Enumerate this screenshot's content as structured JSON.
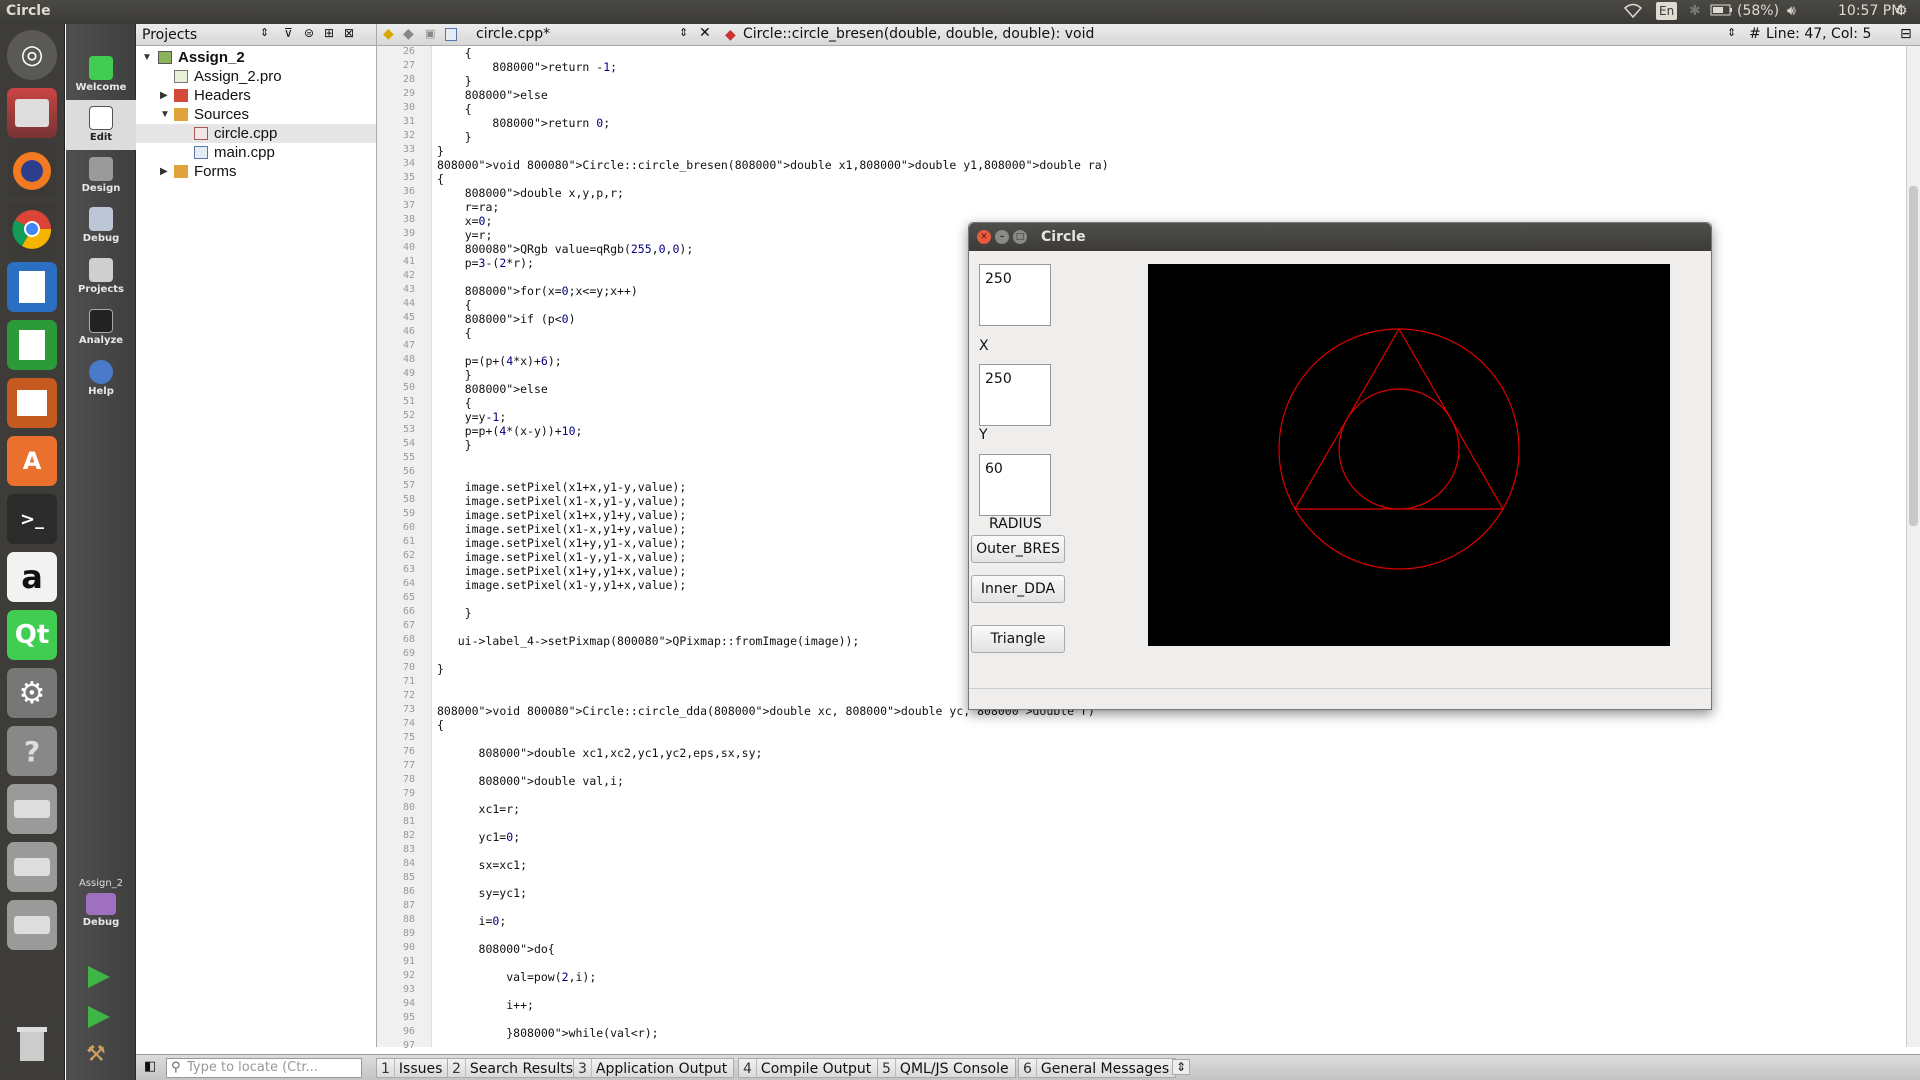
{
  "topbar": {
    "title": "Circle",
    "keyboard": "En",
    "battery": "(58%)",
    "time": "10:57 PM"
  },
  "launcher": {
    "items": [
      "ubuntu-dash",
      "files",
      "firefox",
      "chrome",
      "writer",
      "calc",
      "impress",
      "software-center",
      "terminal",
      "amazon",
      "qt-creator",
      "system-settings",
      "help",
      "drive-1",
      "drive-2",
      "drive-3",
      "trash"
    ]
  },
  "modes": {
    "items": [
      {
        "label": "Welcome",
        "icon": "qt-logo-icon"
      },
      {
        "label": "Edit",
        "icon": "edit-document-icon"
      },
      {
        "label": "Design",
        "icon": "design-pen-icon"
      },
      {
        "label": "Debug",
        "icon": "debug-bug-icon"
      },
      {
        "label": "Projects",
        "icon": "projects-wrench-icon"
      },
      {
        "label": "Analyze",
        "icon": "analyze-monitor-icon"
      },
      {
        "label": "Help",
        "icon": "help-icon"
      }
    ],
    "kit_project": "Assign_2",
    "kit_mode": "Debug"
  },
  "projects": {
    "header": "Projects",
    "tree": [
      {
        "label": "Assign_2",
        "level": 0,
        "twisty": "▼",
        "bold": true
      },
      {
        "label": "Assign_2.pro",
        "level": 1,
        "twisty": ""
      },
      {
        "label": "Headers",
        "level": 1,
        "twisty": "▶"
      },
      {
        "label": "Sources",
        "level": 1,
        "twisty": "▼"
      },
      {
        "label": "circle.cpp",
        "level": 2,
        "twisty": "",
        "selected": true
      },
      {
        "label": "main.cpp",
        "level": 2,
        "twisty": ""
      },
      {
        "label": "Forms",
        "level": 1,
        "twisty": "▶"
      }
    ]
  },
  "editor": {
    "file_name": "circle.cpp*",
    "function_name": "Circle::circle_bresen(double, double, double): void",
    "position": "Line: 47, Col: 5",
    "first_line_number": 26,
    "lines": [
      "    {",
      "        return -1;",
      "    }",
      "    else",
      "    {",
      "        return 0;",
      "    }",
      "}",
      "void Circle::circle_bresen(double x1,double y1,double ra)",
      "{",
      "    double x,y,p,r;",
      "    r=ra;",
      "    x=0;",
      "    y=r;",
      "    QRgb value=qRgb(255,0,0);",
      "    p=3-(2*r);",
      "",
      "    for(x=0;x<=y;x++)",
      "    {",
      "    if (p<0)",
      "    {",
      "",
      "    p=(p+(4*x)+6);",
      "    }",
      "    else",
      "    {",
      "    y=y-1;",
      "    p=p+(4*(x-y))+10;",
      "    }",
      "",
      "",
      "    image.setPixel(x1+x,y1-y,value);",
      "    image.setPixel(x1-x,y1-y,value);",
      "    image.setPixel(x1+x,y1+y,value);",
      "    image.setPixel(x1-x,y1+y,value);",
      "    image.setPixel(x1+y,y1-x,value);",
      "    image.setPixel(x1-y,y1-x,value);",
      "    image.setPixel(x1+y,y1+x,value);",
      "    image.setPixel(x1-y,y1+x,value);",
      "",
      "    }",
      "",
      "   ui->label_4->setPixmap(QPixmap::fromImage(image));",
      "",
      "}",
      "",
      "",
      "void Circle::circle_dda(double xc, double yc, double r)",
      "{",
      "",
      "      double xc1,xc2,yc1,yc2,eps,sx,sy;",
      "",
      "      double val,i;",
      "",
      "      xc1=r;",
      "",
      "      yc1=0;",
      "",
      "      sx=xc1;",
      "",
      "      sy=yc1;",
      "",
      "      i=0;",
      "",
      "      do{",
      "",
      "          val=pow(2,i);",
      "",
      "          i++;",
      "",
      "          }while(val<r);",
      ""
    ]
  },
  "bottom": {
    "locator_placeholder": "Type to locate (Ctr...",
    "tabs": [
      {
        "num": "1",
        "label": "Issues"
      },
      {
        "num": "2",
        "label": "Search Results"
      },
      {
        "num": "3",
        "label": "Application Output"
      },
      {
        "num": "4",
        "label": "Compile Output"
      },
      {
        "num": "5",
        "label": "QML/JS Console"
      },
      {
        "num": "6",
        "label": "General Messages"
      }
    ]
  },
  "dialog": {
    "title": "Circle",
    "x_value": "250",
    "x_label": "X",
    "y_value": "250",
    "y_label": "Y",
    "radius_value": "60",
    "radius_label": "RADIUS",
    "btn_outer": "Outer_BRES",
    "btn_inner": "Inner_DDA",
    "btn_triangle": "Triangle",
    "drawing_color": "#e00000"
  }
}
